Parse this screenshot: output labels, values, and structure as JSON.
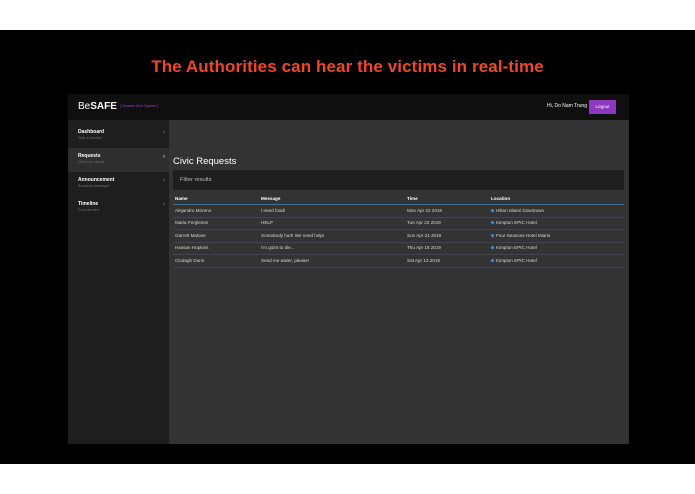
{
  "headline": "The Authorities can hear the victims in real-time",
  "colors": {
    "headline": "#f0472b",
    "accent": "#8e37c0",
    "pin": "#3b8fe0"
  },
  "topbar": {
    "brand_be": "Be",
    "brand_safe": "SAFE",
    "brand_sub": "[ Disaster Alert System ]",
    "greeting": "Hi, Do Nam Trung",
    "logout_label": "Logout"
  },
  "sidebar": {
    "items": [
      {
        "title": "Dashboard",
        "subtitle": "Stats & Number",
        "active": false
      },
      {
        "title": "Requests",
        "subtitle": "Hear from victims",
        "active": true
      },
      {
        "title": "Announcement",
        "subtitle": "Broadcast messages",
        "active": false
      },
      {
        "title": "Timeline",
        "subtitle": "Event timeline",
        "active": false
      }
    ]
  },
  "main": {
    "title": "Civic Requests",
    "filter_placeholder": "Filter results",
    "columns": [
      "Name",
      "Message",
      "Time",
      "Location"
    ],
    "rows": [
      {
        "name": "Alejandro Moreno",
        "message": "I need food!",
        "time": "Mon Apr 22 2019",
        "location": "Hilton Miami Downtown"
      },
      {
        "name": "Maria Fergleson",
        "message": "HELP",
        "time": "Tue Apr 23 2019",
        "location": "Kimpton EPIC Hotel"
      },
      {
        "name": "Garrett Malone",
        "message": "Somebody hurt! We need help!",
        "time": "Sun Apr 21 2019",
        "location": "Four Seasons Hotel Miami"
      },
      {
        "name": "Hassan Hopkins",
        "message": "I'm goint to die...",
        "time": "Thu Apr 18 2019",
        "location": "Kimpton EPIC Hotel"
      },
      {
        "name": "Clodagh Dunn",
        "message": "Send me water, please!",
        "time": "Sat Apr 13 2019",
        "location": "Kimpton EPIC Hotel"
      }
    ]
  }
}
